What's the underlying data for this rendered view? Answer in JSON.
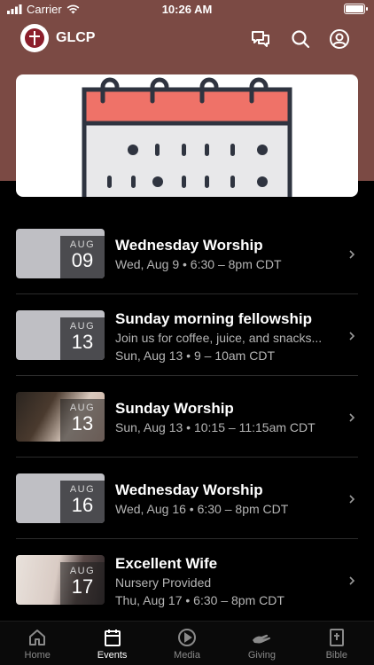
{
  "status": {
    "carrier": "Carrier",
    "time": "10:26 AM"
  },
  "app": {
    "title": "GLCP"
  },
  "events": [
    {
      "month": "AUG",
      "day": "09",
      "title": "Wednesday Worship",
      "line1": "Wed, Aug 9 • 6:30 – 8pm CDT",
      "line2": "",
      "thumb": "gray"
    },
    {
      "month": "AUG",
      "day": "13",
      "title": "Sunday morning fellowship",
      "line1": "Join us for coffee, juice, and snacks...",
      "line2": "Sun, Aug 13 • 9 – 10am CDT",
      "thumb": "gray"
    },
    {
      "month": "AUG",
      "day": "13",
      "title": "Sunday Worship",
      "line1": "Sun, Aug 13 • 10:15 – 11:15am CDT",
      "line2": "",
      "thumb": "photo1"
    },
    {
      "month": "AUG",
      "day": "16",
      "title": "Wednesday Worship",
      "line1": "Wed, Aug 16 • 6:30 – 8pm CDT",
      "line2": "",
      "thumb": "gray"
    },
    {
      "month": "AUG",
      "day": "17",
      "title": "Excellent Wife",
      "line1": "Nursery Provided",
      "line2": "Thu, Aug 17 • 6:30 – 8pm CDT",
      "thumb": "photo2"
    }
  ],
  "tabs": [
    {
      "label": "Home",
      "icon": "home-icon"
    },
    {
      "label": "Events",
      "icon": "calendar-icon",
      "active": true
    },
    {
      "label": "Media",
      "icon": "play-icon"
    },
    {
      "label": "Giving",
      "icon": "giving-hand-icon"
    },
    {
      "label": "Bible",
      "icon": "bible-icon"
    }
  ],
  "colors": {
    "header": "#7b4a44",
    "calendar_accent": "#ef7268"
  }
}
